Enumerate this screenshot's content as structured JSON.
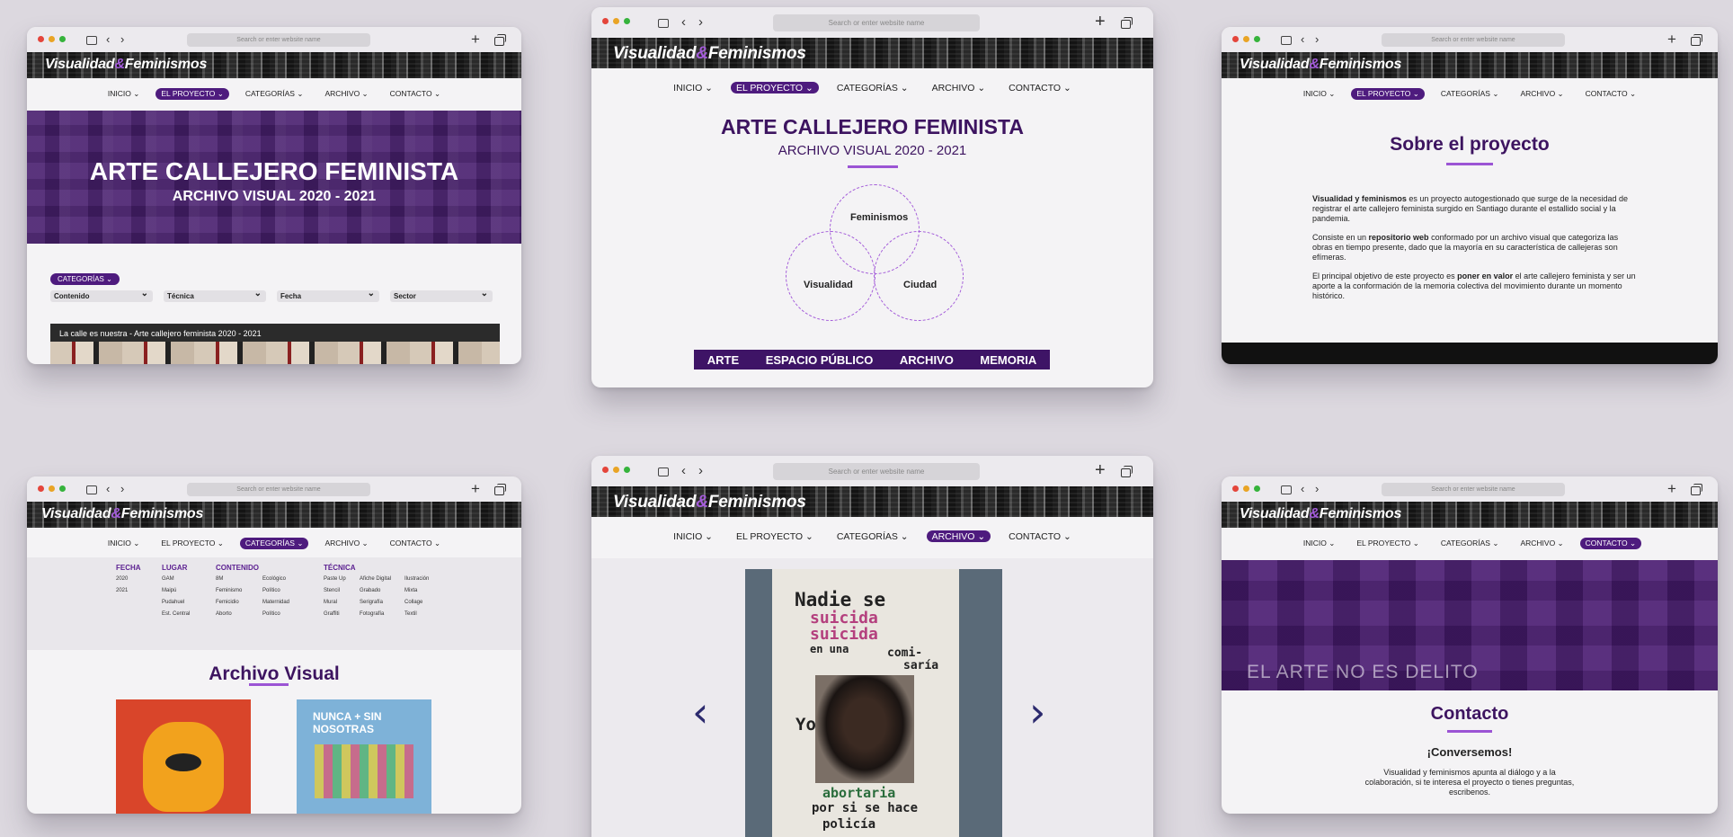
{
  "browser": {
    "url_placeholder": "Search or enter website name"
  },
  "site": {
    "brand_main": "Visualidad",
    "brand_amp": "&",
    "brand_end": "Feminismos"
  },
  "nav": {
    "inicio": "INICIO ⌄",
    "proyecto": "EL PROYECTO ⌄",
    "categorias": "CATEGORÍAS ⌄",
    "archivo": "ARCHIVO ⌄",
    "contacto": "CONTACTO ⌄"
  },
  "home": {
    "hero_title": "ARTE CALLEJERO FEMINISTA",
    "hero_subtitle": "ARCHIVO VISUAL 2020 - 2021",
    "categories_pill": "CATEGORÍAS ⌄",
    "filters": [
      "Contenido",
      "Técnica",
      "Fecha",
      "Sector"
    ],
    "strip_caption": "La calle es nuestra - Arte callejero feminista 2020 - 2021"
  },
  "proyecto": {
    "title": "ARTE CALLEJERO FEMINISTA",
    "subtitle": "ARCHIVO VISUAL 2020 - 2021",
    "venn": [
      "Feminismos",
      "Visualidad",
      "Ciudad"
    ],
    "bar_items": [
      "ARTE",
      "ESPACIO PÚBLICO",
      "ARCHIVO",
      "MEMORIA"
    ]
  },
  "about": {
    "title": "Sobre el proyecto",
    "p1_bold": "Visualidad y feminismos",
    "p1_rest": " es un proyecto autogestionado que surge de la necesidad de registrar el arte callejero feminista surgido en Santiago durante el estallido social y la pandemia.",
    "p2_start": "Consiste en un ",
    "p2_bold": "repositorio web",
    "p2_rest": " conformado por un archivo visual que categoriza las obras en tiempo presente, dado que la mayoría en su característica de callejeras son efímeras.",
    "p3_start": "El principal objetivo de este proyecto es ",
    "p3_bold": "poner en valor",
    "p3_rest": " el arte callejero feminista y ser un aporte a la conformación de la memoria colectiva del movimiento durante un momento histórico."
  },
  "categorias": {
    "fecha": {
      "title": "FECHA",
      "items": [
        "2020",
        "2021"
      ]
    },
    "lugar": {
      "title": "LUGAR",
      "items": [
        "GAM",
        "Maipú",
        "Pudahuel",
        "Est. Central"
      ]
    },
    "contenido": {
      "title": "CONTENIDO",
      "col1": [
        "8M",
        "Feminismo",
        "Femicidio",
        "Aborto"
      ],
      "col2": [
        "Ecológico",
        "Político",
        "Maternidad",
        "Político"
      ]
    },
    "tecnica": {
      "title": "TÉCNICA",
      "col1": [
        "Paste Up",
        "Stencil",
        "Mural",
        "Graffiti"
      ],
      "col2": [
        "Afiche Digital",
        "Grabado",
        "Serigrafía",
        "Fotografía"
      ],
      "col3": [
        "Ilustración",
        "Mixta",
        "Collage",
        "Textil"
      ]
    },
    "section_title": "Archivo Visual",
    "art2_text": "NUNCA + SIN NOSOTRAS"
  },
  "archivo": {
    "poster_lines": [
      "Nadie se",
      "suicida",
      "suicida",
      "en una",
      "comi-",
      "saría",
      "Yo",
      "abortaria",
      "por si se hace",
      "policía"
    ],
    "prev_arrow": "‹",
    "next_arrow": "›"
  },
  "contacto": {
    "graffiti": "EL ARTE NO ES DELITO",
    "title": "Contacto",
    "subtitle": "¡Conversemos!",
    "body": "Visualidad y feminismos apunta al diálogo y a la colaboración, si te interesa el proyecto o tienes preguntas, escribenos."
  },
  "colors": {
    "accent": "#4e1b7e",
    "accent_light": "#a35bd9",
    "title": "#3d1460",
    "background": "#dcd8df"
  }
}
